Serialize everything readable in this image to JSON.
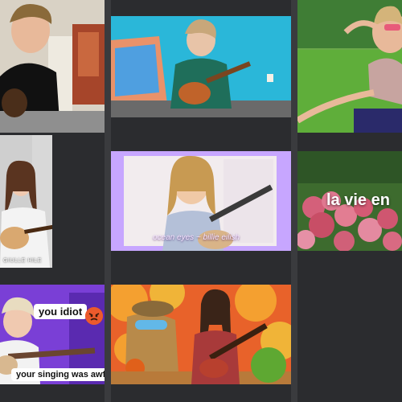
{
  "colors": {
    "background": "#2b2c2f",
    "separator": "#3a3b3e",
    "caption_purple": "#c7a6ff"
  },
  "tiles": {
    "t1": {
      "name": "participant-top-left",
      "caption": ""
    },
    "t2": {
      "name": "participant-top-center",
      "caption": ""
    },
    "t3": {
      "name": "participant-top-right",
      "caption": ""
    },
    "t4": {
      "name": "participant-mid-left",
      "caption": "GIULLE HILE"
    },
    "t5": {
      "name": "participant-mid-center",
      "caption": "ocean eyes ~ billie eilish"
    },
    "t6": {
      "name": "participant-mid-right",
      "caption": "la vie en"
    },
    "t7": {
      "name": "participant-bottom-left",
      "bubble1": "you idiot",
      "emoji": "angry-face-icon",
      "bubble2": "your singing was awful."
    },
    "t8": {
      "name": "participant-bottom-center",
      "caption": ""
    }
  }
}
